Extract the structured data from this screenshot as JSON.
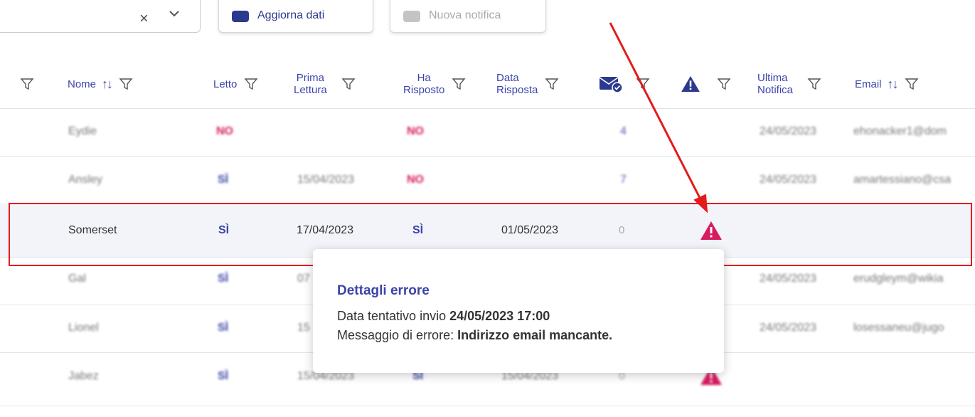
{
  "toolbar": {
    "search_clear": "×",
    "refresh_label": "Aggiorna dati",
    "new_notification_label": "Nuova notifica"
  },
  "columns": {
    "nome": "Nome",
    "letto": "Letto",
    "prima_lettura_1": "Prima",
    "prima_lettura_2": "Lettura",
    "ha_risposto_1": "Ha",
    "ha_risposto_2": "Risposto",
    "data_risposta_1": "Data",
    "data_risposta_2": "Risposta",
    "ultima_notifica_1": "Ultima",
    "ultima_notifica_2": "Notifica",
    "email": "Email",
    "sort_glyph": "↑↓"
  },
  "rows": [
    {
      "nome": "Eydie",
      "letto": "NO",
      "prima_lettura": "",
      "ha_risposto": "NO",
      "data_risposta": "",
      "count": "4",
      "ultima_notifica": "24/05/2023",
      "email": "ehonacker1@dom"
    },
    {
      "nome": "Ansley",
      "letto": "SÌ",
      "prima_lettura": "15/04/2023",
      "ha_risposto": "NO",
      "data_risposta": "",
      "count": "7",
      "ultima_notifica": "24/05/2023",
      "email": "amartessiano@csa"
    },
    {
      "nome": "Somerset",
      "letto": "SÌ",
      "prima_lettura": "17/04/2023",
      "ha_risposto": "SÌ",
      "data_risposta": "01/05/2023",
      "count": "0",
      "ultima_notifica": "",
      "email": ""
    },
    {
      "nome": "Gal",
      "letto": "SÌ",
      "prima_lettura": "07",
      "ha_risposto": "",
      "data_risposta": "",
      "count": "",
      "ultima_notifica": "24/05/2023",
      "email": "erudgleym@wikia"
    },
    {
      "nome": "Lionel",
      "letto": "SÌ",
      "prima_lettura": "15",
      "ha_risposto": "",
      "data_risposta": "",
      "count": "",
      "ultima_notifica": "24/05/2023",
      "email": "losessaneu@jugo"
    },
    {
      "nome": "Jabez",
      "letto": "SÌ",
      "prima_lettura": "15/04/2023",
      "ha_risposto": "SÌ",
      "data_risposta": "15/04/2023",
      "count": "0",
      "ultima_notifica": "",
      "email": ""
    }
  ],
  "tooltip": {
    "title": "Dettagli errore",
    "line1_label": "Data tentativo invio ",
    "line1_value": "24/05/2023 17:00",
    "line2_label": "Messaggio di errore: ",
    "line2_value": "Indirizzo email mancante."
  },
  "colors": {
    "accent": "#3b45a8",
    "no": "#d81b60",
    "warning": "#d81b60",
    "highlight_border": "#e31b1b"
  },
  "icons": [
    "filter-icon",
    "sort-icon",
    "mail-check-icon",
    "warning-icon",
    "download-icon",
    "mail-icon",
    "chevron-down-icon"
  ]
}
